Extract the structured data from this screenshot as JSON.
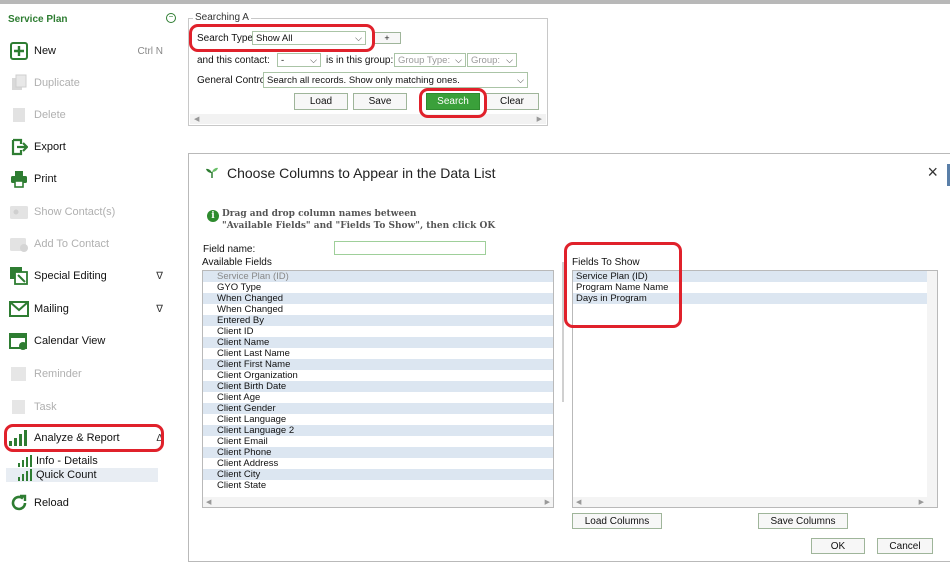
{
  "sidebar": {
    "title": "Service Plan",
    "items": [
      {
        "label": "New",
        "shortcut": "Ctrl N",
        "icon": "plus-box-icon",
        "enabled": true
      },
      {
        "label": "Duplicate",
        "icon": "duplicate-icon",
        "enabled": false
      },
      {
        "label": "Delete",
        "icon": "delete-icon",
        "enabled": false
      },
      {
        "label": "Export",
        "icon": "export-icon",
        "enabled": true
      },
      {
        "label": "Print",
        "icon": "printer-icon",
        "enabled": true
      },
      {
        "label": "Show Contact(s)",
        "icon": "contact-card-icon",
        "enabled": false
      },
      {
        "label": "Add To Contact",
        "icon": "add-contact-icon",
        "enabled": false
      },
      {
        "label": "Special Editing",
        "icon": "special-edit-icon",
        "enabled": true,
        "caret": "∇"
      },
      {
        "label": "Mailing",
        "icon": "mail-icon",
        "enabled": true,
        "caret": "∇"
      },
      {
        "label": "Calendar View",
        "icon": "calendar-icon",
        "enabled": true
      },
      {
        "label": "Reminder",
        "icon": "reminder-icon",
        "enabled": false
      },
      {
        "label": "Task",
        "icon": "task-icon",
        "enabled": false
      },
      {
        "label": "Analyze & Report",
        "icon": "bar-chart-icon",
        "enabled": true,
        "caret": "Δ"
      }
    ],
    "sub_items": [
      {
        "label": "Info - Details",
        "icon": "mini-chart-icon"
      },
      {
        "label": "Quick Count",
        "icon": "mini-chart-icon",
        "selected": true
      }
    ],
    "reload_label": "Reload",
    "accent": "#2e7d32"
  },
  "search": {
    "legend": "Searching A",
    "search_type_label": "Search Type:",
    "search_type_value": "Show All",
    "plus_label": "+",
    "contact_label": "and this contact:",
    "contact_value": "-",
    "group_label": "is in this group:",
    "group_type_placeholder": "Group Type:",
    "group_placeholder": "Group:",
    "general_label": "General Control:",
    "general_value": "Search all records. Show only matching ones.",
    "buttons": {
      "load": "Load",
      "save": "Save",
      "search": "Search",
      "clear": "Clear"
    }
  },
  "dialog": {
    "title": "Choose Columns to Appear in the Data List",
    "close": "×",
    "info_line1": "Drag and drop column names between",
    "info_line2": "\"Available Fields\" and \"Fields To Show\", then click OK",
    "field_name_label": "Field name:",
    "available_header": "Available Fields",
    "fields_header": "Fields To Show",
    "available_fields": [
      "Service Plan (ID)",
      "GYO Type",
      "When Changed",
      "When Changed",
      "Entered By",
      "Client ID",
      "Client Name",
      "Client Last Name",
      "Client First Name",
      "Client Organization",
      "Client Birth Date",
      "Client Age",
      "Client Gender",
      "Client Language",
      "Client Language 2",
      "Client Email",
      "Client Phone",
      "Client Address",
      "Client City",
      "Client State"
    ],
    "fields_to_show": [
      "Service Plan (ID)",
      "Program Name Name",
      "Days in Program"
    ],
    "buttons": {
      "load_columns": "Load Columns",
      "save_columns": "Save Columns",
      "ok": "OK",
      "cancel": "Cancel"
    }
  },
  "colors": {
    "highlight": "#e0212b",
    "row_alt": "#dce6f1",
    "search_button": "#3aa03a"
  }
}
